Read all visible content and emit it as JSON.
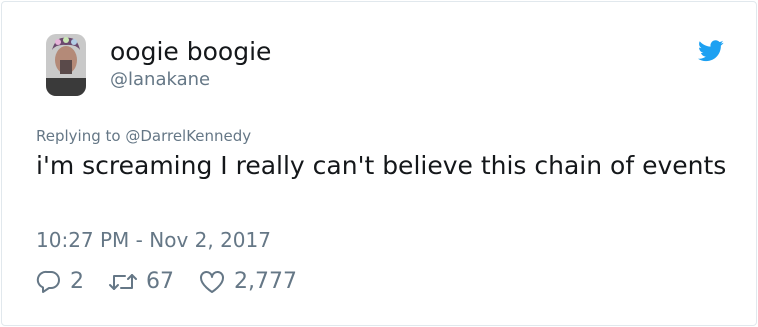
{
  "user": {
    "display_name": "oogie boogie",
    "handle": "@lanakane"
  },
  "tweet": {
    "replying_to": "Replying to @DarrelKennedy",
    "text": "i'm screaming I really can't believe this chain of events",
    "timestamp": "10:27 PM - Nov 2, 2017"
  },
  "actions": {
    "reply_count": "2",
    "retweet_count": "67",
    "like_count": "2,777"
  },
  "colors": {
    "brand_blue": "#1da1f2",
    "secondary_text": "#657786",
    "primary_text": "#14171a",
    "border": "#e1e8ed"
  },
  "icons": {
    "brand": "twitter-bird-icon",
    "reply": "reply-bubble-icon",
    "retweet": "retweet-icon",
    "like": "heart-icon"
  }
}
